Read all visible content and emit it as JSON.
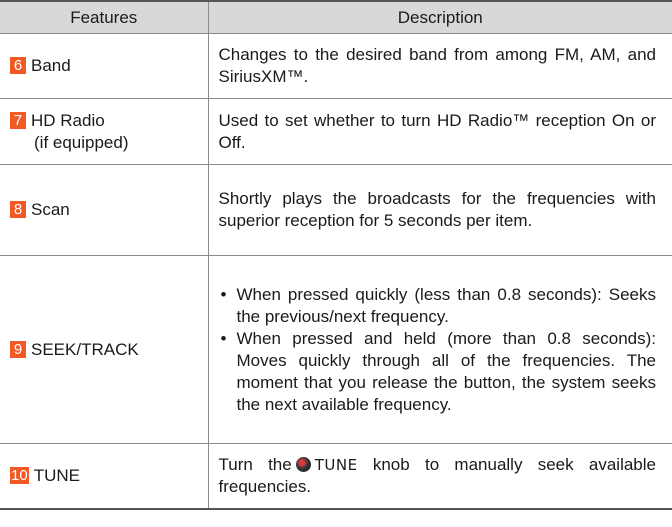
{
  "header": {
    "features": "Features",
    "description": "Description"
  },
  "rows": [
    {
      "num": "6",
      "feature": "Band",
      "feature_sub": "",
      "description": "Changes to the desired band from among FM, AM, and SiriusXM™."
    },
    {
      "num": "7",
      "feature": "HD Radio",
      "feature_sub": "(if equipped)",
      "description": "Used to set whether to turn HD Radio™ reception On or Off."
    },
    {
      "num": "8",
      "feature": "Scan",
      "feature_sub": "",
      "description": "Shortly plays the broadcasts for the frequencies with superior reception for 5 seconds per item."
    },
    {
      "num": "9",
      "feature": "SEEK/TRACK",
      "feature_sub": "",
      "bullets": [
        "When pressed quickly (less than 0.8 seconds): Seeks the previous/next frequency.",
        "When pressed and held (more than 0.8 seconds): Moves quickly through all of the frequencies. The moment that you release the button, the system seeks the next available frequency."
      ]
    },
    {
      "num": "10",
      "feature": "TUNE",
      "feature_sub": "",
      "desc_pre": "Turn the",
      "desc_knob": "TUNE",
      "desc_post": "knob to manually seek available frequencies."
    }
  ]
}
